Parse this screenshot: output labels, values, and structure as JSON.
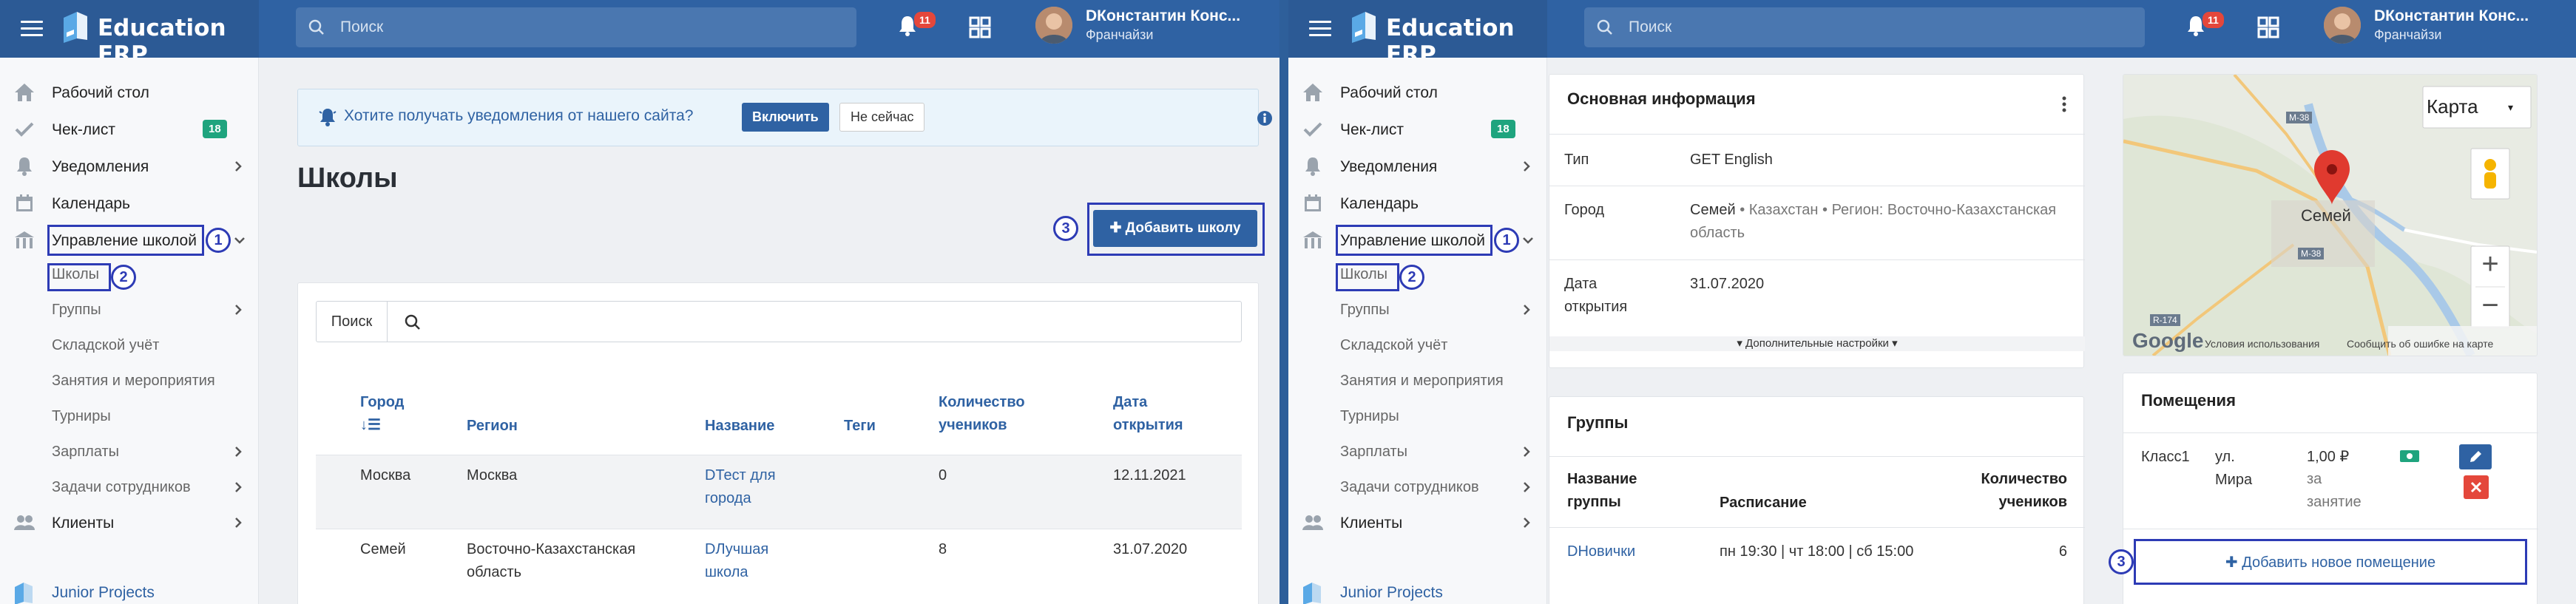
{
  "app": {
    "title": "Education ERP",
    "search_placeholder": "Поиск",
    "notifications_count": "11",
    "user_name": "DКонстантин Конс...",
    "user_role": "Франчайзи"
  },
  "sidebar": {
    "items": [
      {
        "label": "Рабочий стол"
      },
      {
        "label": "Чек-лист",
        "count": "18"
      },
      {
        "label": "Уведомления"
      },
      {
        "label": "Календарь"
      },
      {
        "label": "Управление школой"
      },
      {
        "label": "Школы"
      },
      {
        "label": "Группы"
      },
      {
        "label": "Складской учёт"
      },
      {
        "label": "Занятия и мероприятия"
      },
      {
        "label": "Турниры"
      },
      {
        "label": "Зарплаты"
      },
      {
        "label": "Задачи сотрудников"
      },
      {
        "label": "Клиенты"
      }
    ],
    "footer": "Junior Projects"
  },
  "markers": {
    "m1": "1",
    "m2": "2",
    "m3": "3"
  },
  "left": {
    "notice": {
      "text": "Хотите получать уведомления от нашего сайта?",
      "enable": "Включить",
      "later": "Не сейчас"
    },
    "page_title": "Школы",
    "add_button": "Добавить школу",
    "search_label": "Поиск",
    "columns": {
      "city": "Город",
      "region": "Регион",
      "name": "Название",
      "tags": "Теги",
      "count": "Количество учеников",
      "opened": "Дата открытия"
    },
    "rows": [
      {
        "city": "Москва",
        "region": "Москва",
        "name": "DТест для города",
        "tags": "",
        "count": "0",
        "opened": "12.11.2021"
      },
      {
        "city": "Семей",
        "region": "Восточно-Казахстанская область",
        "name": "DЛучшая школа",
        "tags": "",
        "count": "8",
        "opened": "31.07.2020"
      }
    ]
  },
  "right": {
    "info": {
      "title": "Основная информация",
      "type_label": "Тип",
      "type_value": "GET English",
      "city_label": "Город",
      "city_value": "Семей",
      "city_rest": "• Казахстан • Регион: Восточно-Казахстанская область",
      "date_label": "Дата открытия",
      "date_value": "31.07.2020",
      "more": "Дополнительные настройки"
    },
    "map": {
      "type_button": "Карта",
      "city": "Семей",
      "terms": "Условия использования",
      "report": "Сообщить об ошибке на карте",
      "road1": "M-38",
      "road2": "M-38",
      "road3": "R-174",
      "google": "Google",
      "zoom_in": "+",
      "zoom_out": "−"
    },
    "groups": {
      "title": "Группы",
      "col_name": "Название группы",
      "col_schedule": "Расписание",
      "col_count": "Количество учеников",
      "rows": [
        {
          "name": "DНовички",
          "schedule": "пн 19:30 | чт 18:00 | сб 15:00",
          "count": "6"
        }
      ]
    },
    "rooms": {
      "title": "Помещения",
      "rows": [
        {
          "name": "Класс1",
          "address": "ул. Мира",
          "price": "1,00 ₽",
          "per": "за занятие"
        }
      ],
      "add": "Добавить новое помещение"
    }
  }
}
